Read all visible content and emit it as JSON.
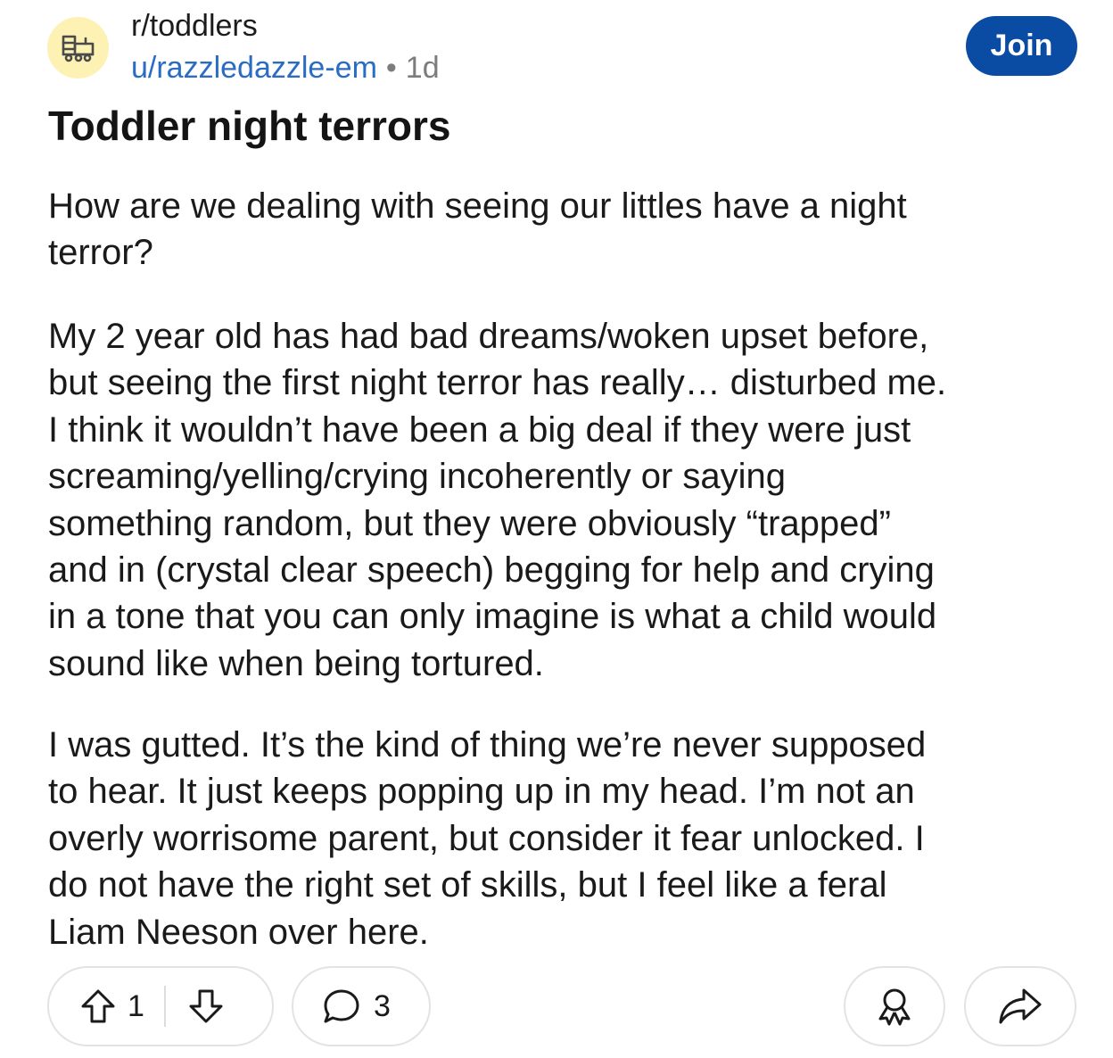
{
  "post": {
    "subreddit": "r/toddlers",
    "author": "u/razzledazzle-em",
    "separator": "•",
    "age": "1d",
    "join_label": "Join",
    "title": "Toddler night terrors",
    "paragraphs": [
      [
        "How are we dealing with seeing our littles have a night",
        "terror?"
      ],
      [
        "My 2 year old has had bad dreams/woken upset before,",
        "but seeing the first night terror has really… disturbed me.",
        "I think it wouldn’t have been a big deal if they were just",
        "screaming/yelling/crying incoherently or saying",
        "something random, but they were obviously “trapped”",
        "and in (crystal clear speech) begging for help and crying",
        "in a tone that you can only imagine is what a child would",
        "sound like when being tortured."
      ],
      [
        "I was gutted. It’s the kind of thing we’re never supposed",
        "to hear. It just keeps popping up in my head. I’m not an",
        "overly worrisome parent, but consider it fear unlocked. I",
        "do not have the right set of skills, but I feel like a feral",
        "Liam Neeson over here."
      ]
    ]
  },
  "actions": {
    "upvote_count": "1",
    "comment_count": "3"
  },
  "icons": {
    "subreddit_avatar": "train-icon",
    "upvote": "arrow-up-icon",
    "downvote": "arrow-down-icon",
    "comments": "speech-bubble-icon",
    "award": "award-ribbon-icon",
    "share": "share-arrow-icon"
  },
  "colors": {
    "join_button": "#0a4ca4",
    "username": "#2a6cc4",
    "avatar_bg": "#fdf1b3"
  }
}
